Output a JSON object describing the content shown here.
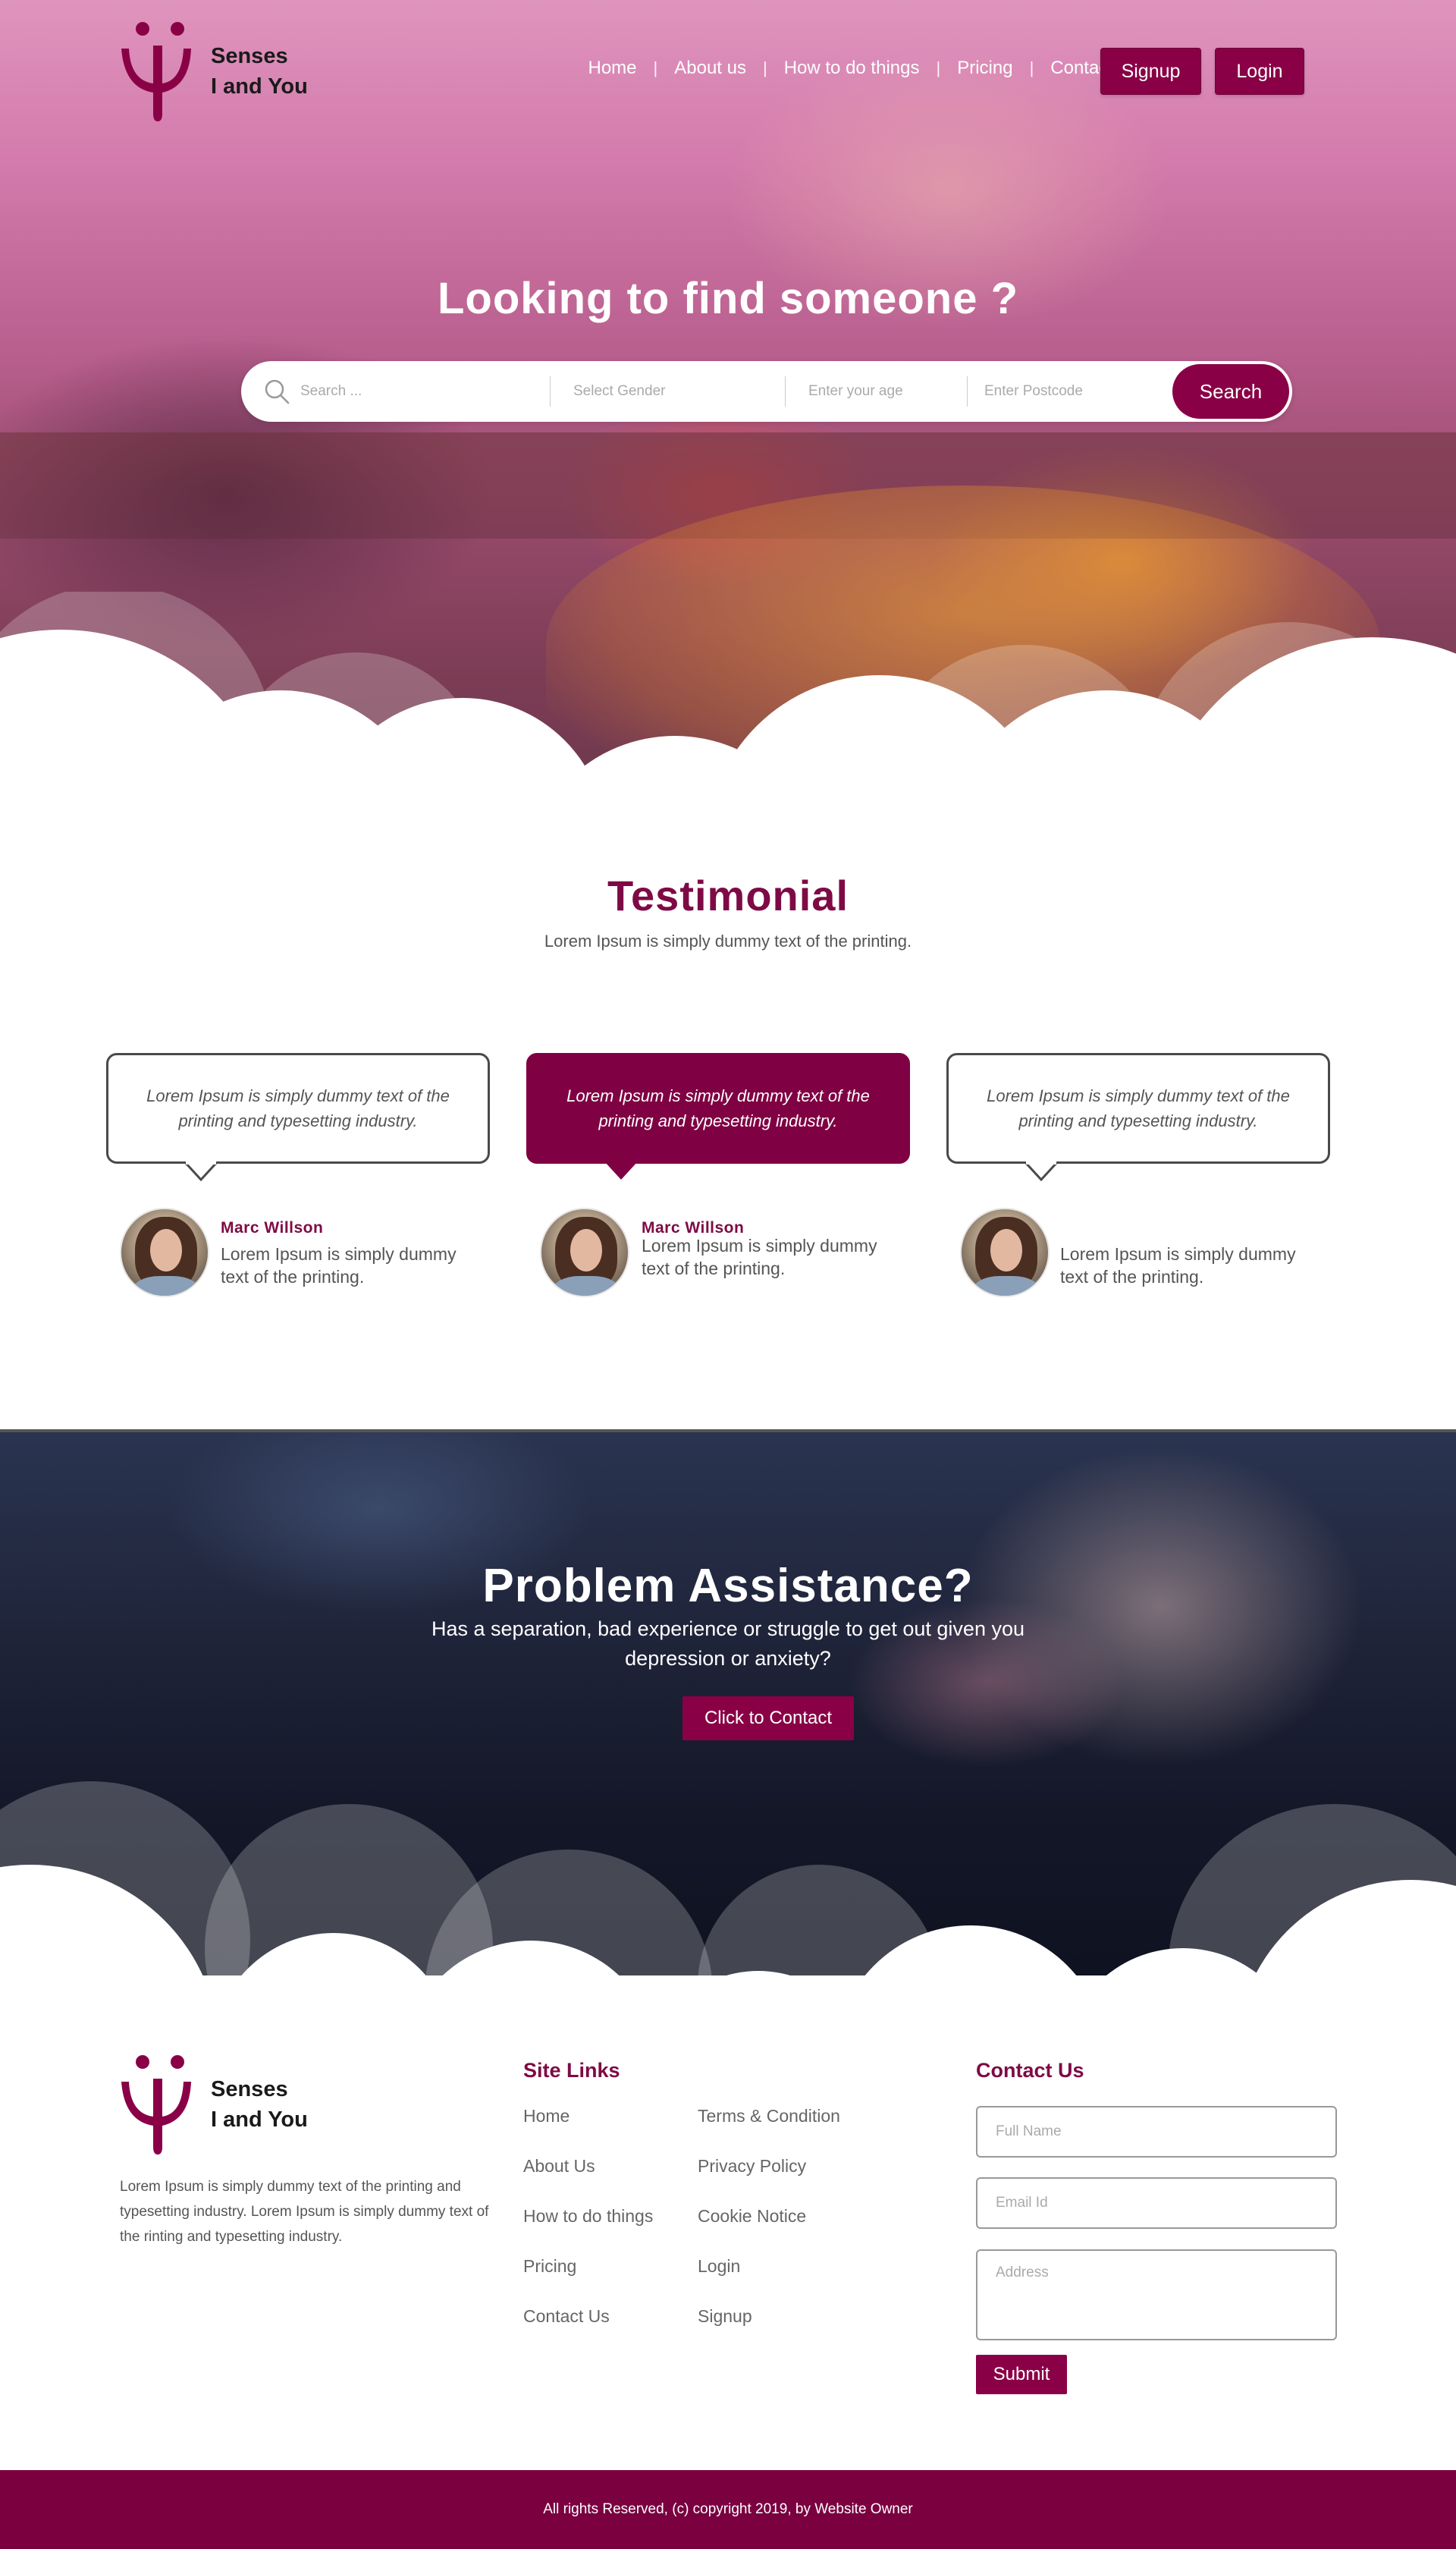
{
  "brand": {
    "line1": "Senses",
    "line2": "I and You"
  },
  "colors": {
    "accent": "#8a0046",
    "heading": "#7e0a45",
    "footer_bar": "#7a0040"
  },
  "nav": {
    "items": [
      {
        "label": "Home"
      },
      {
        "label": "About us"
      },
      {
        "label": "How to do things"
      },
      {
        "label": "Pricing"
      },
      {
        "label": "Contact"
      }
    ],
    "signup_label": "Signup",
    "login_label": "Login"
  },
  "hero": {
    "title": "Looking to find someone ?",
    "search": {
      "placeholder": "Search ...",
      "gender": "Select Gender",
      "age": "Enter your age",
      "postcode": "Enter Postcode",
      "button": "Search",
      "icon": "search-icon"
    }
  },
  "testimonial": {
    "title": "Testimonial",
    "subtitle": "Lorem Ipsum is simply dummy text of the printing.",
    "items": [
      {
        "quote": "Lorem Ipsum is simply dummy text of the printing and typesetting industry.",
        "name": "Marc Willson",
        "text": "Lorem Ipsum is simply dummy text of the printing.",
        "active": false
      },
      {
        "quote": "Lorem Ipsum is simply dummy text of the printing and typesetting industry.",
        "name": "Marc Willson",
        "text": "Lorem Ipsum is simply dummy text of the printing.",
        "active": true
      },
      {
        "quote": "Lorem Ipsum is simply dummy text of the printing and typesetting industry.",
        "name": "",
        "text": "Lorem Ipsum is simply dummy text of the printing.",
        "active": false
      }
    ]
  },
  "assist": {
    "title": "Problem Assistance?",
    "subtitle": "Has a separation, bad experience or struggle to get out given you depression or anxiety?",
    "button": "Click to Contact"
  },
  "footer": {
    "about": "Lorem Ipsum is simply dummy text of the  printing and typesetting industry. Lorem  Ipsum is simply dummy text of the   rinting and typesetting industry.",
    "site_links_title": "Site Links",
    "links_col1": [
      "Home",
      "About Us",
      "How to do things",
      "Pricing",
      "Contact Us"
    ],
    "links_col2": [
      "Terms & Condition",
      "Privacy Policy",
      "Cookie Notice",
      "Login",
      "Signup"
    ],
    "contact_title": "Contact Us",
    "form": {
      "name_placeholder": "Full Name",
      "email_placeholder": "Email Id",
      "address_placeholder": "Address",
      "submit": "Submit"
    },
    "copyright": "All rights Reserved, (c) copyright 2019, by Website Owner"
  }
}
